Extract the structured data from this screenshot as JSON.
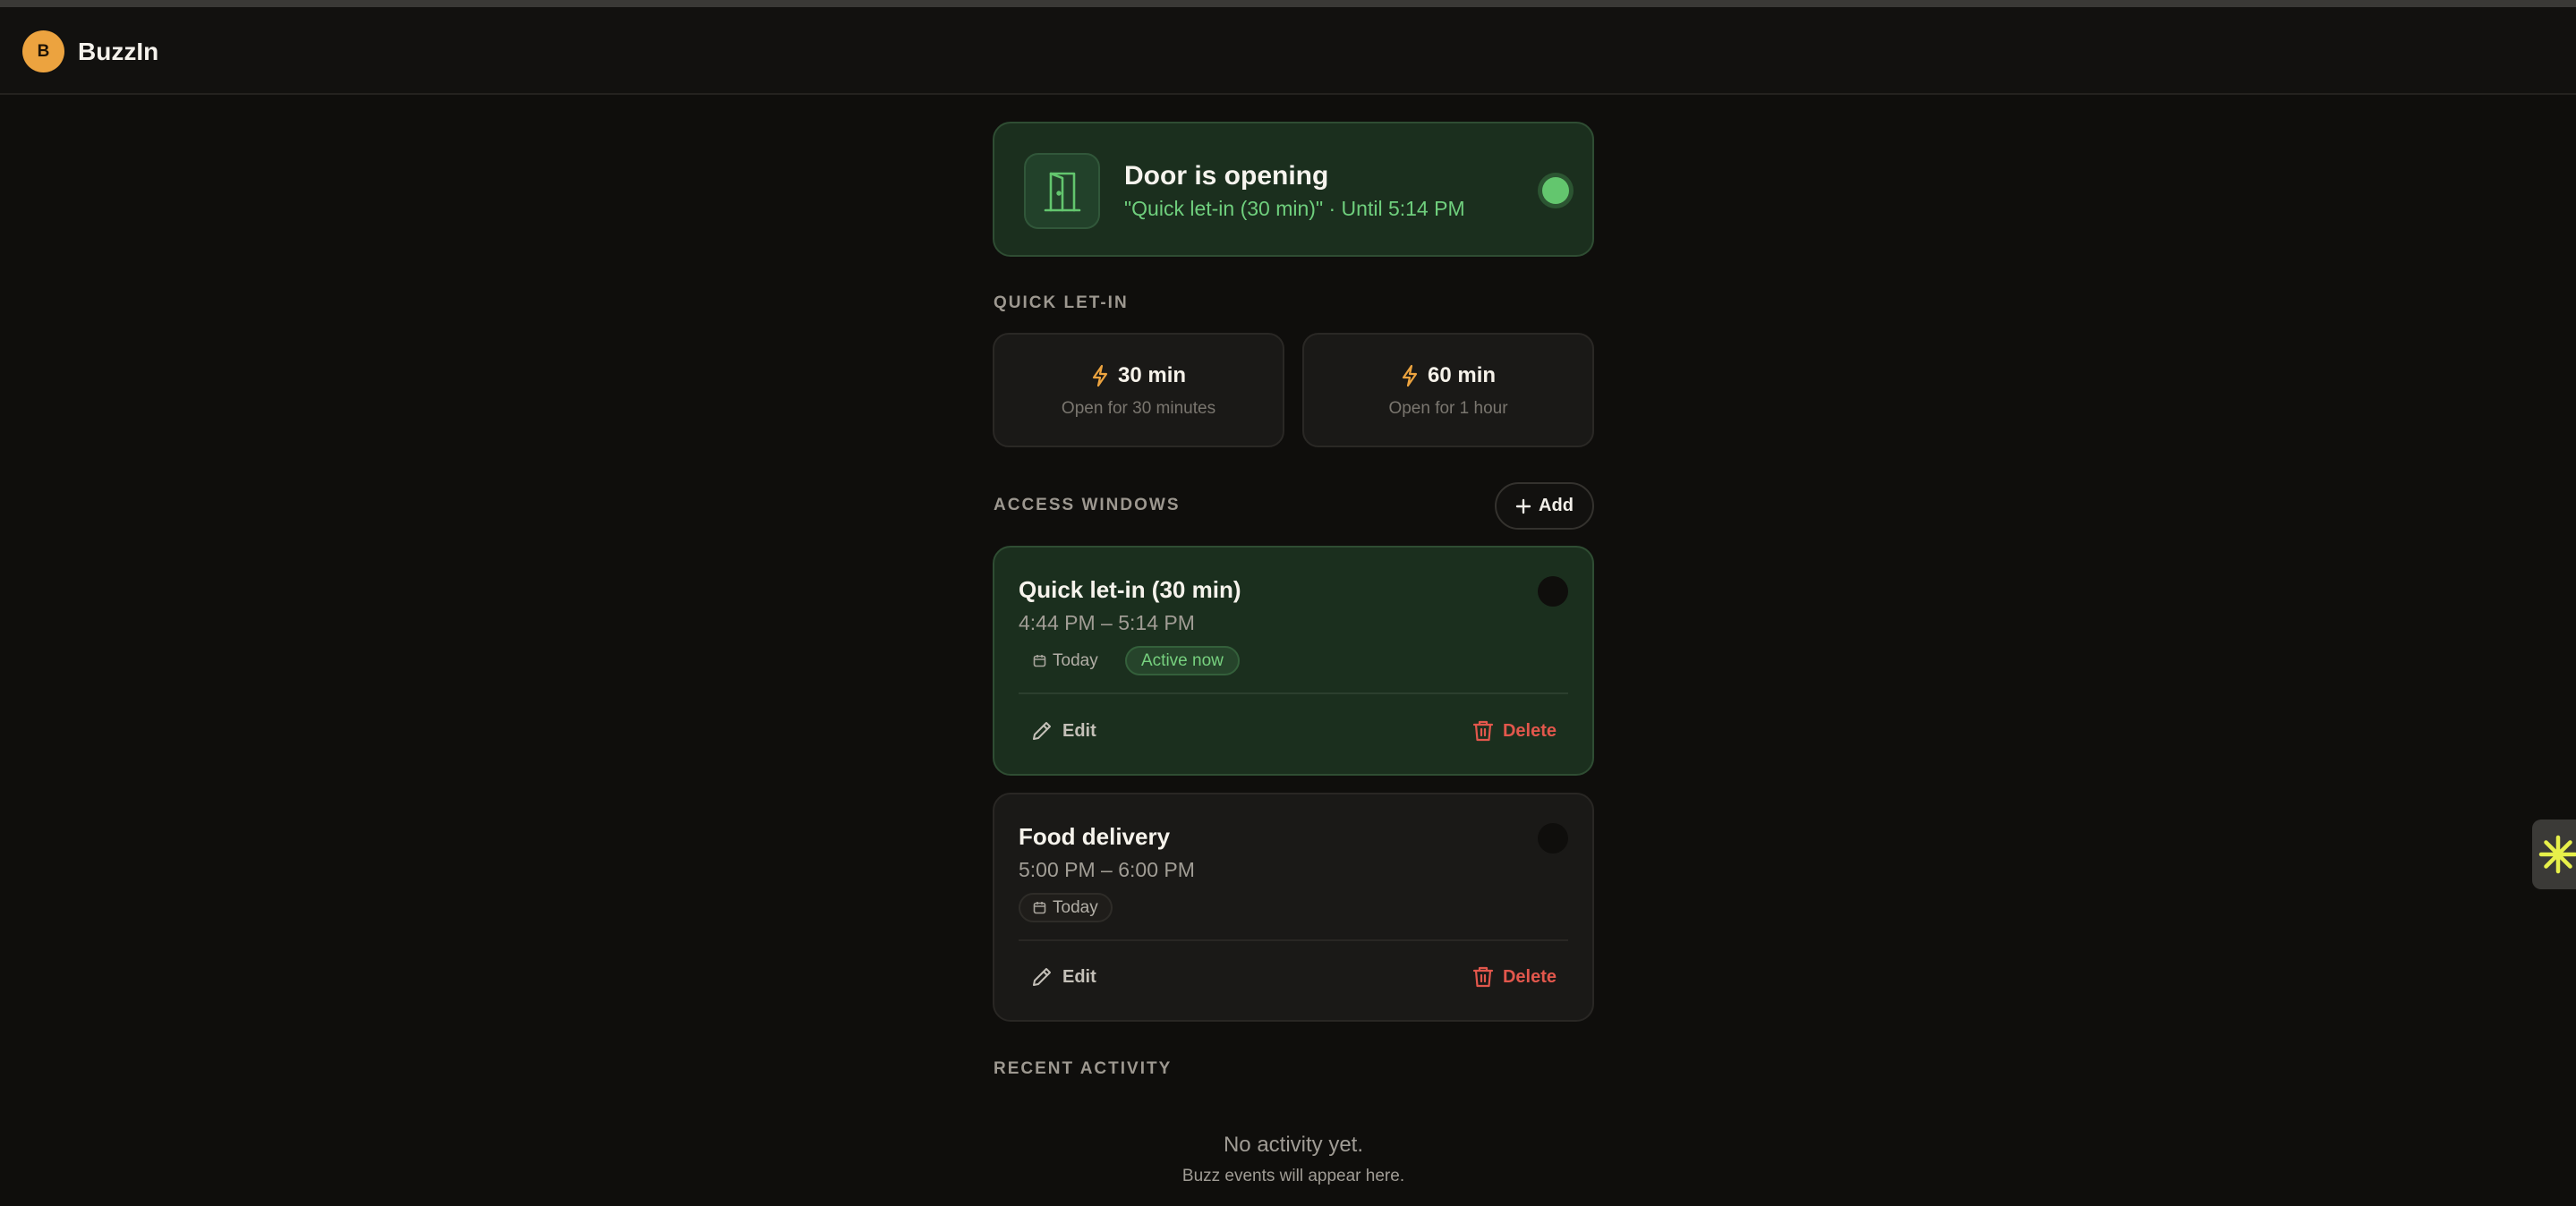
{
  "app": {
    "brand": "BuzzIn",
    "logo_letter": "B",
    "accent": "#eca33f"
  },
  "status": {
    "title": "Door is opening",
    "subtitle": "\"Quick let-in (30 min)\" · Until 5:14 PM",
    "icon": "door-open-icon",
    "indicator_color": "#63c66e"
  },
  "quick_let_in": {
    "label": "QUICK LET-IN",
    "options": [
      {
        "title": "30 min",
        "subtitle": "Open for 30 minutes",
        "icon": "lightning-icon"
      },
      {
        "title": "60 min",
        "subtitle": "Open for 1 hour",
        "icon": "lightning-icon"
      }
    ]
  },
  "access_windows": {
    "label": "ACCESS WINDOWS",
    "add_label": "Add",
    "items": [
      {
        "title": "Quick let-in (30 min)",
        "time": "4:44 PM – 5:14 PM",
        "day": "Today",
        "badge": "Active now",
        "edit_label": "Edit",
        "delete_label": "Delete"
      },
      {
        "title": "Food delivery",
        "time": "5:00 PM – 6:00 PM",
        "day": "Today",
        "edit_label": "Edit",
        "delete_label": "Delete"
      }
    ]
  },
  "recent_activity": {
    "label": "RECENT ACTIVITY",
    "empty_title": "No activity yet.",
    "empty_subtitle": "Buzz events will appear here."
  },
  "colors": {
    "background": "#0f0e0c",
    "active_green": "#6fcf7d",
    "danger": "#e2574c"
  }
}
